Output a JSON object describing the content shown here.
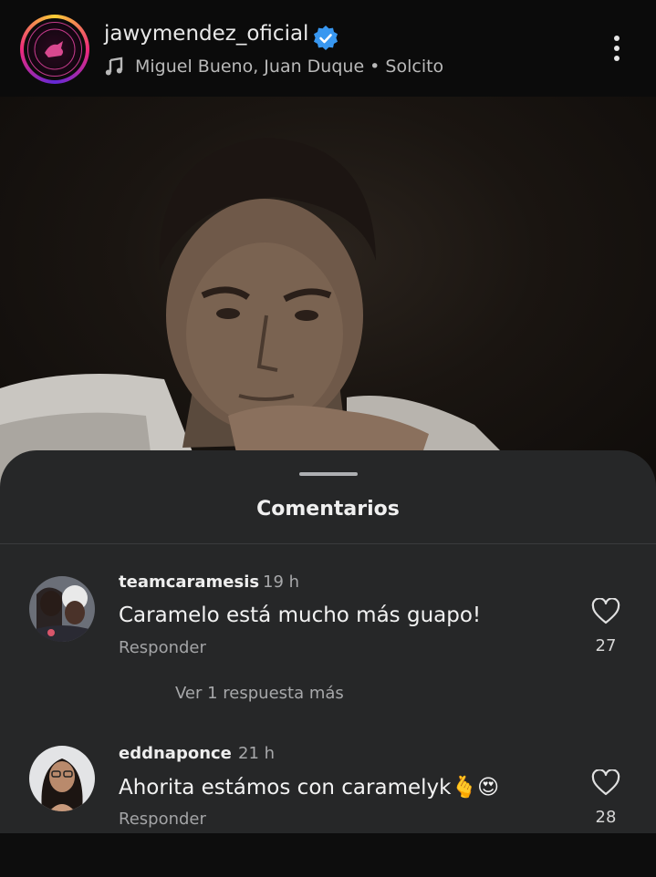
{
  "header": {
    "username": "jawymendez_oficial",
    "music": "Miguel Bueno, Juan Duque • Solcito"
  },
  "sheet": {
    "title": "Comentarios",
    "comments": [
      {
        "user": "teamcaramesis",
        "time": "19 h",
        "text": "Caramelo está mucho más guapo!",
        "reply_label": "Responder",
        "likes": "27",
        "view_replies": "Ver 1 respuesta más"
      },
      {
        "user": "eddnaponce",
        "time": "21 h",
        "text": "Ahorita estámos con caramelyk🫰😍",
        "reply_label": "Responder",
        "likes": "28"
      }
    ]
  },
  "colors": {
    "sheet_bg": "#262728",
    "verified_blue": "#3897f0"
  },
  "icons": [
    "more-options-icon",
    "verified-badge-icon",
    "music-note-icon",
    "heart-icon"
  ]
}
